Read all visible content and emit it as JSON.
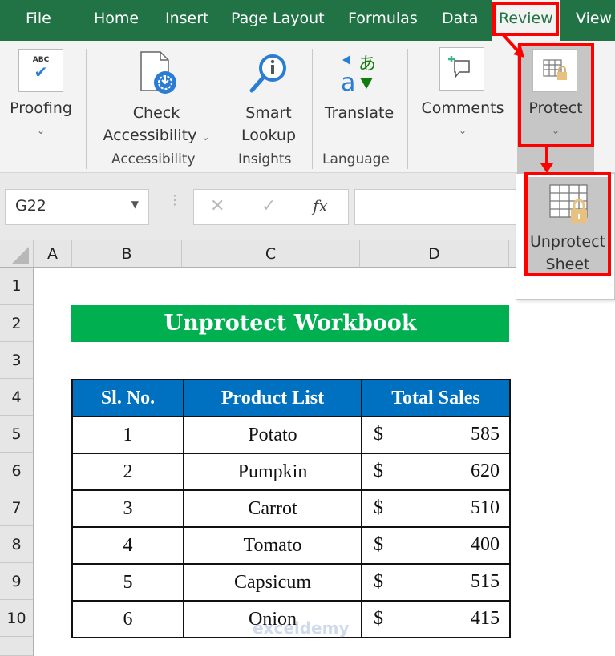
{
  "ribbon_tabs": [
    "File",
    "Home",
    "Insert",
    "Page Layout",
    "Formulas",
    "Data",
    "Review",
    "View"
  ],
  "active_tab": "Review",
  "ribbon": {
    "proofing": {
      "label": "Proofing",
      "icon": "spelling-abc-check-icon"
    },
    "check_accessibility": {
      "line1": "Check",
      "line2": "Accessibility",
      "icon": "accessibility-checker-icon"
    },
    "smart_lookup": {
      "line1": "Smart",
      "line2": "Lookup",
      "icon": "smart-lookup-icon"
    },
    "translate": {
      "label": "Translate",
      "icon": "translate-icon"
    },
    "comments": {
      "label": "Comments",
      "icon": "new-comment-icon"
    },
    "protect": {
      "label": "Protect",
      "icon": "protect-sheet-icon"
    },
    "groups": {
      "accessibility": "Accessibility",
      "insights": "Insights",
      "language": "Language"
    }
  },
  "dropdown": {
    "line1": "Unprotect",
    "line2": "Sheet",
    "icon": "unprotect-sheet-icon"
  },
  "formula_bar": {
    "name_box": "G22",
    "cancel": "✕",
    "enter": "✓",
    "fx": "fx",
    "value": ""
  },
  "columns": [
    "A",
    "B",
    "C",
    "D"
  ],
  "rows": [
    "1",
    "2",
    "3",
    "4",
    "5",
    "6",
    "7",
    "8",
    "9",
    "10"
  ],
  "sheet": {
    "title": "Unprotect Workbook",
    "headers": [
      "Sl. No.",
      "Product List",
      "Total Sales"
    ],
    "rows": [
      {
        "sl": "1",
        "product": "Potato",
        "currency": "$",
        "sales": "585"
      },
      {
        "sl": "2",
        "product": "Pumpkin",
        "currency": "$",
        "sales": "620"
      },
      {
        "sl": "3",
        "product": "Carrot",
        "currency": "$",
        "sales": "510"
      },
      {
        "sl": "4",
        "product": "Tomato",
        "currency": "$",
        "sales": "400"
      },
      {
        "sl": "5",
        "product": "Capsicum",
        "currency": "$",
        "sales": "515"
      },
      {
        "sl": "6",
        "product": "Onion",
        "currency": "$",
        "sales": "415"
      }
    ]
  },
  "watermark": "exceldemy",
  "colors": {
    "tab_green": "#217346",
    "title_green": "#00b050",
    "header_blue": "#0070c0",
    "highlight_red": "#ff0000"
  }
}
